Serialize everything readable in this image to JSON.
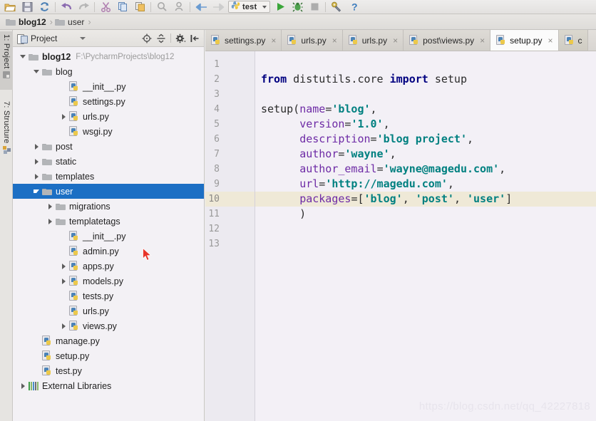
{
  "toolbar": {
    "buttons": [
      {
        "name": "open-folder-icon",
        "label": "Open"
      },
      {
        "name": "save-icon",
        "label": "Save All"
      },
      {
        "name": "sync-icon",
        "label": "Synchronize"
      },
      {
        "name": "undo-icon",
        "label": "Undo"
      },
      {
        "name": "redo-icon",
        "label": "Redo"
      },
      {
        "name": "cut-icon",
        "label": "Cut"
      },
      {
        "name": "copy-icon",
        "label": "Copy"
      },
      {
        "name": "paste-icon",
        "label": "Paste"
      },
      {
        "name": "find-icon",
        "label": "Find"
      },
      {
        "name": "find-usages-icon",
        "label": "Find Usages"
      },
      {
        "name": "back-icon",
        "label": "Back"
      },
      {
        "name": "forward-icon",
        "label": "Forward"
      }
    ],
    "run_config": {
      "name": "test",
      "icon": "python-icon",
      "dropdown": "chevron-down-icon"
    },
    "run_buttons": [
      {
        "name": "run-button",
        "label": "Run"
      },
      {
        "name": "debug-button",
        "label": "Debug"
      },
      {
        "name": "stop-button",
        "label": "Stop"
      },
      {
        "name": "settings-wrench-button",
        "label": "Settings"
      },
      {
        "name": "help-button",
        "label": "?"
      }
    ]
  },
  "breadcrumb": {
    "items": [
      {
        "label": "blog12",
        "icon": "folder-icon"
      },
      {
        "label": "user",
        "icon": "folder-icon"
      }
    ],
    "separator": "›"
  },
  "left_strip": {
    "tabs": [
      {
        "label": "1: Project",
        "icon": "project-icon",
        "active": true
      },
      {
        "label": "7: Structure",
        "icon": "structure-icon",
        "active": false
      }
    ]
  },
  "project_panel": {
    "title": "Project",
    "title_icon": "project-view-icon",
    "dropdown_icon": "chevron-down-icon",
    "tools": [
      {
        "name": "locate-target-icon",
        "label": "Select Opened File"
      },
      {
        "name": "collapse-all-icon",
        "label": "Collapse All"
      },
      {
        "name": "gear-icon",
        "label": "Settings"
      },
      {
        "name": "hide-panel-icon",
        "label": "Hide"
      }
    ],
    "tree": [
      {
        "label": "blog12",
        "suffix": "F:\\PycharmProjects\\blog12",
        "indent": 0,
        "arrow": "down",
        "icon": "folder-icon",
        "bold": true,
        "selected": false
      },
      {
        "label": "blog",
        "suffix": "",
        "indent": 1,
        "arrow": "down",
        "icon": "folder-icon",
        "bold": false,
        "selected": false
      },
      {
        "label": "__init__.py",
        "suffix": "",
        "indent": 3,
        "arrow": "none",
        "icon": "python-file-icon",
        "bold": false,
        "selected": false
      },
      {
        "label": "settings.py",
        "suffix": "",
        "indent": 3,
        "arrow": "none",
        "icon": "python-file-icon",
        "bold": false,
        "selected": false
      },
      {
        "label": "urls.py",
        "suffix": "",
        "indent": 3,
        "arrow": "right",
        "icon": "python-file-icon",
        "bold": false,
        "selected": false
      },
      {
        "label": "wsgi.py",
        "suffix": "",
        "indent": 3,
        "arrow": "none",
        "icon": "python-file-icon",
        "bold": false,
        "selected": false
      },
      {
        "label": "post",
        "suffix": "",
        "indent": 1,
        "arrow": "right",
        "icon": "folder-icon",
        "bold": false,
        "selected": false
      },
      {
        "label": "static",
        "suffix": "",
        "indent": 1,
        "arrow": "right",
        "icon": "folder-icon",
        "bold": false,
        "selected": false
      },
      {
        "label": "templates",
        "suffix": "",
        "indent": 1,
        "arrow": "right",
        "icon": "folder-icon",
        "bold": false,
        "selected": false
      },
      {
        "label": "user",
        "suffix": "",
        "indent": 1,
        "arrow": "down",
        "icon": "folder-icon",
        "bold": false,
        "selected": true
      },
      {
        "label": "migrations",
        "suffix": "",
        "indent": 2,
        "arrow": "right",
        "icon": "folder-icon",
        "bold": false,
        "selected": false
      },
      {
        "label": "templatetags",
        "suffix": "",
        "indent": 2,
        "arrow": "right",
        "icon": "folder-icon",
        "bold": false,
        "selected": false
      },
      {
        "label": "__init__.py",
        "suffix": "",
        "indent": 3,
        "arrow": "none",
        "icon": "python-file-icon",
        "bold": false,
        "selected": false
      },
      {
        "label": "admin.py",
        "suffix": "",
        "indent": 3,
        "arrow": "none",
        "icon": "python-file-icon",
        "bold": false,
        "selected": false
      },
      {
        "label": "apps.py",
        "suffix": "",
        "indent": 3,
        "arrow": "right",
        "icon": "python-file-icon",
        "bold": false,
        "selected": false
      },
      {
        "label": "models.py",
        "suffix": "",
        "indent": 3,
        "arrow": "right",
        "icon": "python-file-icon",
        "bold": false,
        "selected": false
      },
      {
        "label": "tests.py",
        "suffix": "",
        "indent": 3,
        "arrow": "none",
        "icon": "python-file-icon",
        "bold": false,
        "selected": false
      },
      {
        "label": "urls.py",
        "suffix": "",
        "indent": 3,
        "arrow": "none",
        "icon": "python-file-icon",
        "bold": false,
        "selected": false
      },
      {
        "label": "views.py",
        "suffix": "",
        "indent": 3,
        "arrow": "right",
        "icon": "python-file-icon",
        "bold": false,
        "selected": false
      },
      {
        "label": "manage.py",
        "suffix": "",
        "indent": 1,
        "arrow": "none",
        "icon": "python-file-icon",
        "bold": false,
        "selected": false
      },
      {
        "label": "setup.py",
        "suffix": "",
        "indent": 1,
        "arrow": "none",
        "icon": "python-file-icon",
        "bold": false,
        "selected": false
      },
      {
        "label": "test.py",
        "suffix": "",
        "indent": 1,
        "arrow": "none",
        "icon": "python-file-icon",
        "bold": false,
        "selected": false
      },
      {
        "label": "External Libraries",
        "suffix": "",
        "indent": 0,
        "arrow": "right",
        "icon": "library-icon",
        "bold": false,
        "selected": false
      }
    ]
  },
  "editor": {
    "tabs": [
      {
        "label": "settings.py",
        "icon": "python-file-icon",
        "active": false,
        "close": "×"
      },
      {
        "label": "urls.py",
        "icon": "python-file-icon",
        "active": false,
        "close": "×"
      },
      {
        "label": "urls.py",
        "icon": "python-file-icon",
        "active": false,
        "close": "×"
      },
      {
        "label": "post\\views.py",
        "icon": "python-file-icon",
        "active": false,
        "close": "×"
      },
      {
        "label": "setup.py",
        "icon": "python-file-icon",
        "active": true,
        "close": "×"
      },
      {
        "label": "c",
        "icon": "python-file-icon",
        "active": false,
        "close": ""
      }
    ],
    "current_line": 10,
    "line_numbers": [
      "1",
      "2",
      "3",
      "4",
      "5",
      "6",
      "7",
      "8",
      "9",
      "10",
      "11",
      "12",
      "13"
    ],
    "code_lines": [
      {
        "n": 1,
        "tokens": []
      },
      {
        "n": 2,
        "tokens": [
          {
            "t": "from",
            "c": "kw"
          },
          {
            "t": " distutils.core ",
            "c": "plain"
          },
          {
            "t": "import",
            "c": "kw"
          },
          {
            "t": " setup",
            "c": "plain"
          }
        ]
      },
      {
        "n": 3,
        "tokens": []
      },
      {
        "n": 4,
        "tokens": [
          {
            "t": "setup(",
            "c": "plain"
          },
          {
            "t": "name",
            "c": "param"
          },
          {
            "t": "=",
            "c": "plain"
          },
          {
            "t": "'blog'",
            "c": "str"
          },
          {
            "t": ",",
            "c": "plain"
          }
        ]
      },
      {
        "n": 5,
        "tokens": [
          {
            "t": "      ",
            "c": "plain"
          },
          {
            "t": "version",
            "c": "param"
          },
          {
            "t": "=",
            "c": "plain"
          },
          {
            "t": "'1.0'",
            "c": "str"
          },
          {
            "t": ",",
            "c": "plain"
          }
        ]
      },
      {
        "n": 6,
        "tokens": [
          {
            "t": "      ",
            "c": "plain"
          },
          {
            "t": "description",
            "c": "param"
          },
          {
            "t": "=",
            "c": "plain"
          },
          {
            "t": "'blog project'",
            "c": "str"
          },
          {
            "t": ",",
            "c": "plain"
          }
        ]
      },
      {
        "n": 7,
        "tokens": [
          {
            "t": "      ",
            "c": "plain"
          },
          {
            "t": "author",
            "c": "param"
          },
          {
            "t": "=",
            "c": "plain"
          },
          {
            "t": "'wayne'",
            "c": "str"
          },
          {
            "t": ",",
            "c": "plain"
          }
        ]
      },
      {
        "n": 8,
        "tokens": [
          {
            "t": "      ",
            "c": "plain"
          },
          {
            "t": "author_email",
            "c": "param"
          },
          {
            "t": "=",
            "c": "plain"
          },
          {
            "t": "'wayne@magedu.com'",
            "c": "str"
          },
          {
            "t": ",",
            "c": "plain"
          }
        ]
      },
      {
        "n": 9,
        "tokens": [
          {
            "t": "      ",
            "c": "plain"
          },
          {
            "t": "url",
            "c": "param"
          },
          {
            "t": "=",
            "c": "plain"
          },
          {
            "t": "'http://magedu.com'",
            "c": "str"
          },
          {
            "t": ",",
            "c": "plain"
          }
        ]
      },
      {
        "n": 10,
        "tokens": [
          {
            "t": "      ",
            "c": "plain"
          },
          {
            "t": "packages",
            "c": "param"
          },
          {
            "t": "=[",
            "c": "plain"
          },
          {
            "t": "'blog'",
            "c": "str"
          },
          {
            "t": ", ",
            "c": "plain"
          },
          {
            "t": "'post'",
            "c": "str"
          },
          {
            "t": ", ",
            "c": "plain"
          },
          {
            "t": "'user'",
            "c": "str"
          },
          {
            "t": "]",
            "c": "plain"
          }
        ]
      },
      {
        "n": 11,
        "tokens": [
          {
            "t": "      )",
            "c": "plain"
          }
        ]
      },
      {
        "n": 12,
        "tokens": []
      },
      {
        "n": 13,
        "tokens": []
      }
    ],
    "watermark": "https://blog.csdn.net/qq_42227818"
  },
  "colors": {
    "accent_selection": "#1c6fc4",
    "current_line": "#efe9d7",
    "editor_bg": "#f3f0f6",
    "keyword": "#000080",
    "string": "#008080",
    "param": "#6d2aa5",
    "cursor": "#e8342a"
  }
}
